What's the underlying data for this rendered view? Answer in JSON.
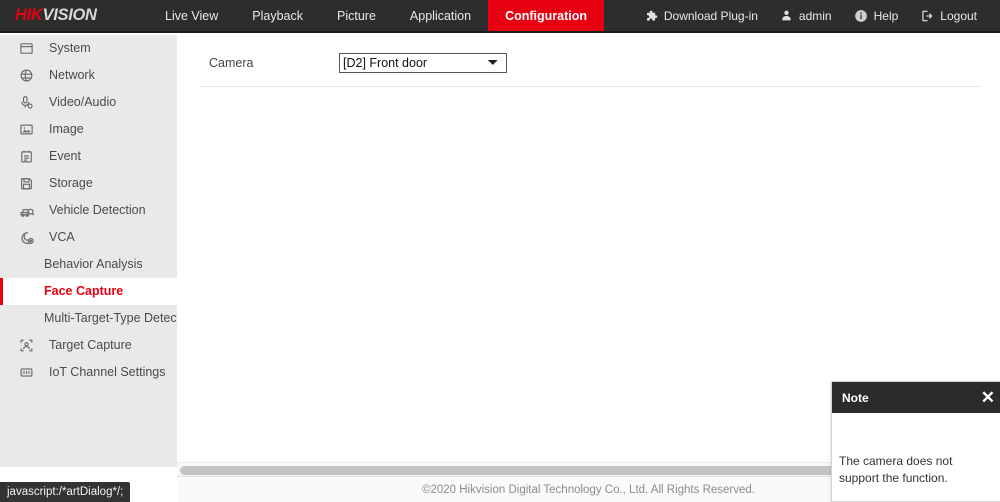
{
  "brand": {
    "logo_hik": "HIK",
    "logo_vision": "VISION",
    "accent_color": "#e60012",
    "header_bg": "#2d2d2d",
    "sidebar_bg": "#e9e9e9"
  },
  "nav": {
    "items": [
      {
        "label": "Live View",
        "active": false
      },
      {
        "label": "Playback",
        "active": false
      },
      {
        "label": "Picture",
        "active": false
      },
      {
        "label": "Application",
        "active": false
      },
      {
        "label": "Configuration",
        "active": true
      }
    ]
  },
  "header_right": {
    "items": [
      {
        "label": "Download Plug-in",
        "icon": "puzzle-icon"
      },
      {
        "label": "admin",
        "icon": "user-icon"
      },
      {
        "label": "Help",
        "icon": "info-icon"
      },
      {
        "label": "Logout",
        "icon": "logout-icon"
      }
    ]
  },
  "sidebar": {
    "items": [
      {
        "label": "System",
        "icon": "window-icon",
        "sub": false,
        "active": false
      },
      {
        "label": "Network",
        "icon": "globe-icon",
        "sub": false,
        "active": false
      },
      {
        "label": "Video/Audio",
        "icon": "microphone-icon",
        "sub": false,
        "active": false
      },
      {
        "label": "Image",
        "icon": "picture-icon",
        "sub": false,
        "active": false
      },
      {
        "label": "Event",
        "icon": "calendar-icon",
        "sub": false,
        "active": false
      },
      {
        "label": "Storage",
        "icon": "floppy-disk-icon",
        "sub": false,
        "active": false
      },
      {
        "label": "Vehicle Detection",
        "icon": "car-search-icon",
        "sub": false,
        "active": false
      },
      {
        "label": "VCA",
        "icon": "vca-icon",
        "sub": false,
        "active": false
      },
      {
        "label": "Behavior Analysis",
        "icon": "",
        "sub": true,
        "active": false
      },
      {
        "label": "Face Capture",
        "icon": "",
        "sub": true,
        "active": true
      },
      {
        "label": "Multi-Target-Type Detection",
        "icon": "",
        "sub": true,
        "active": false
      },
      {
        "label": "Target Capture",
        "icon": "target-person-icon",
        "sub": false,
        "active": false
      },
      {
        "label": "IoT Channel Settings",
        "icon": "chip-icon",
        "sub": false,
        "active": false
      }
    ]
  },
  "main": {
    "camera_label": "Camera",
    "camera_value": "[D2] Front door",
    "camera_options": [
      "[D2] Front door"
    ]
  },
  "dialog": {
    "title": "Note",
    "close_label": "✕",
    "message": "The camera does not support the function."
  },
  "footer": {
    "copyright": "©2020 Hikvision Digital Technology Co., Ltd. All Rights Reserved."
  },
  "status_bar": {
    "text": "javascript:/*artDialog*/;"
  }
}
